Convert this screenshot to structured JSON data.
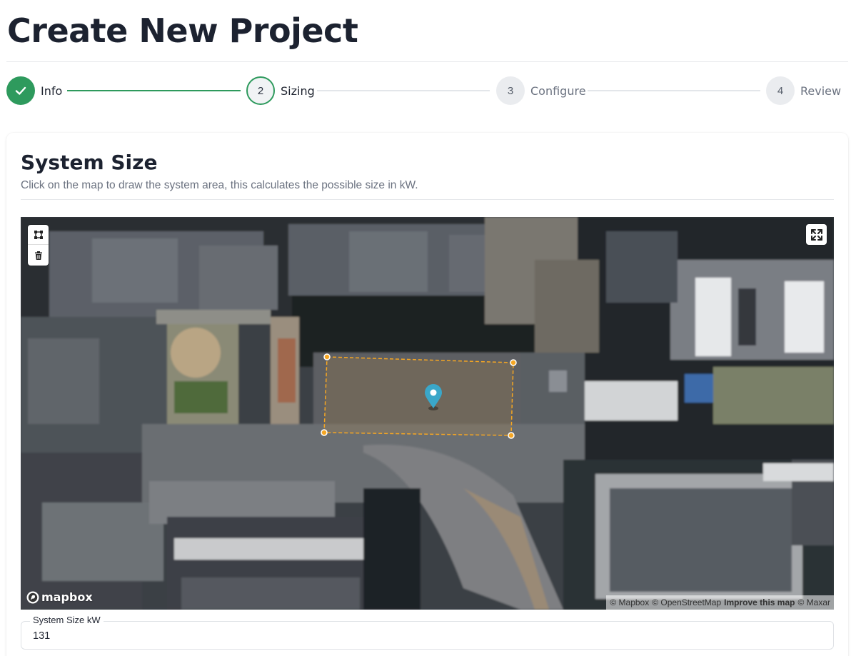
{
  "page": {
    "title": "Create New Project"
  },
  "stepper": {
    "steps": [
      {
        "number": "1",
        "label": "Info",
        "state": "complete"
      },
      {
        "number": "2",
        "label": "Sizing",
        "state": "active"
      },
      {
        "number": "3",
        "label": "Configure",
        "state": "pending"
      },
      {
        "number": "4",
        "label": "Review",
        "state": "pending"
      }
    ]
  },
  "card": {
    "title": "System Size",
    "subtitle": "Click on the map to draw the system area, this calculates the possible size in kW."
  },
  "map": {
    "logo_text": "mapbox",
    "attribution": {
      "mapbox": "© Mapbox",
      "osm": "© OpenStreetMap",
      "improve": "Improve this map",
      "maxar": "© Maxar"
    },
    "controls": {
      "polygon_icon": "polygon-draw-icon",
      "trash_icon": "trash-icon",
      "fullscreen_icon": "fullscreen-icon"
    },
    "marker_icon": "map-pin-icon",
    "polygon_color": "#f5a623",
    "marker_color": "#3aa7c9"
  },
  "form": {
    "system_size_label": "System Size kW",
    "system_size_value": "131"
  },
  "colors": {
    "success": "#2e9a5d",
    "muted_text": "#6b7280",
    "title_text": "#1c2230"
  }
}
